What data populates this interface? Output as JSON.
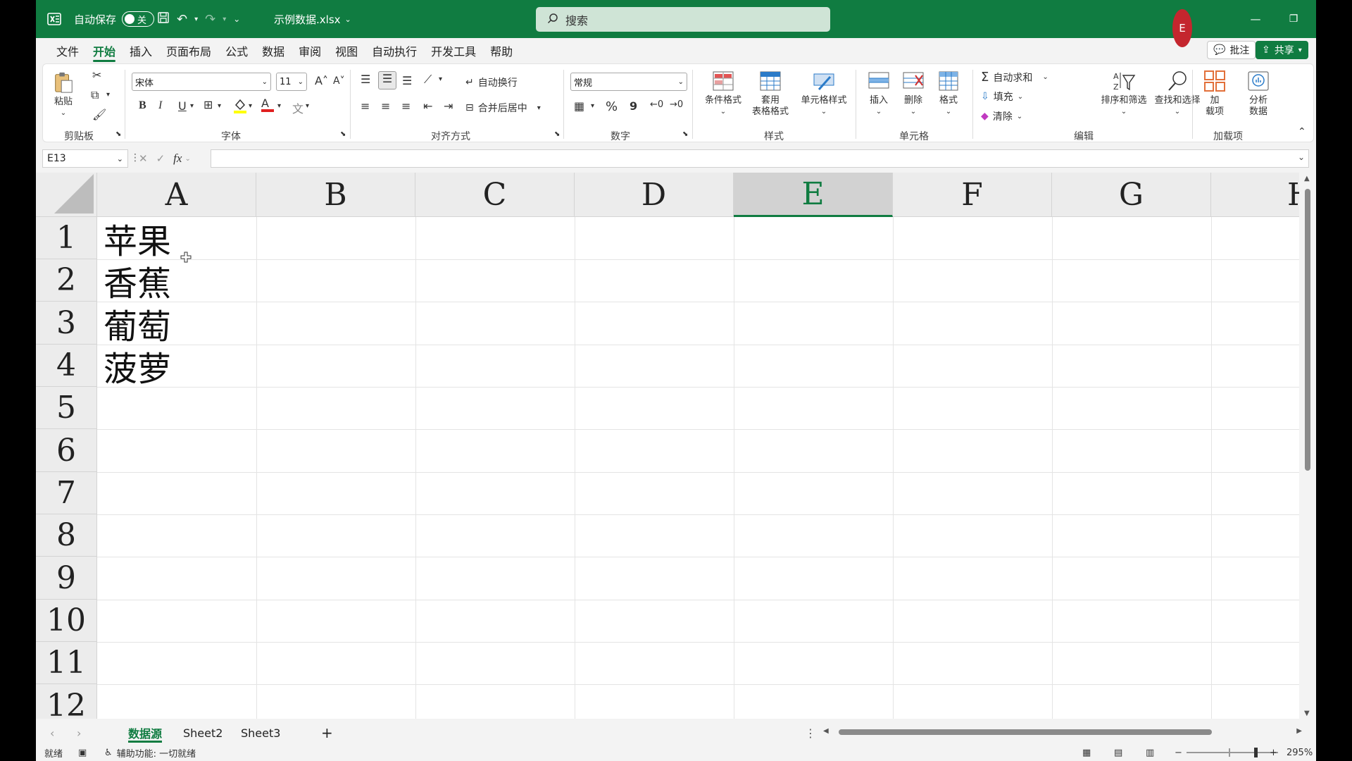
{
  "titlebar": {
    "autosave_label": "自动保存",
    "toggle_state": "关",
    "filename": "示例数据.xlsx",
    "search_placeholder": "搜索",
    "avatar_initial": "E"
  },
  "tabs": [
    "文件",
    "开始",
    "插入",
    "页面布局",
    "公式",
    "数据",
    "审阅",
    "视图",
    "自动执行",
    "开发工具",
    "帮助"
  ],
  "active_tab": "开始",
  "comments_label": "批注",
  "share_label": "共享",
  "ribbon": {
    "clipboard": {
      "paste": "粘贴",
      "group": "剪贴板"
    },
    "font": {
      "name": "宋体",
      "size": "11",
      "group": "字体",
      "bold": "B",
      "italic": "I",
      "underline": "U",
      "font_color_letter": "A",
      "grow": "A",
      "shrink": "A"
    },
    "align": {
      "wrap": "自动换行",
      "merge": "合并后居中",
      "group": "对齐方式"
    },
    "number": {
      "format": "常规",
      "percent": "%",
      "comma": "9",
      "group": "数字"
    },
    "styles": {
      "cond": "条件格式",
      "table1": "套用",
      "table2": "表格格式",
      "cell": "单元格样式",
      "group": "样式"
    },
    "cells": {
      "insert": "插入",
      "delete": "删除",
      "format": "格式",
      "group": "单元格"
    },
    "editing": {
      "autosum": "自动求和",
      "fill": "填充",
      "clear": "清除",
      "sort": "排序和筛选",
      "find": "查找和选择",
      "group": "编辑"
    },
    "addins": {
      "addin1": "加",
      "addin2": "载项",
      "analyze1": "分析",
      "analyze2": "数据",
      "group": "加载项"
    }
  },
  "formula": {
    "name_box": "E13",
    "fx": "fx",
    "value": ""
  },
  "columns": [
    "A",
    "B",
    "C",
    "D",
    "E",
    "F",
    "G",
    "H"
  ],
  "selected_column": "E",
  "rows": [
    "1",
    "2",
    "3",
    "4",
    "5",
    "6",
    "7",
    "8",
    "9",
    "10",
    "11",
    "12"
  ],
  "cells_a": [
    "苹果",
    "香蕉",
    "葡萄",
    "菠萝"
  ],
  "sheets": [
    "数据源",
    "Sheet2",
    "Sheet3"
  ],
  "active_sheet": "数据源",
  "status": {
    "ready": "就绪",
    "accessibility": "辅助功能: 一切就绪",
    "zoom": "295%"
  },
  "colors": {
    "brand": "#107c41",
    "avatar": "#c4262e"
  }
}
